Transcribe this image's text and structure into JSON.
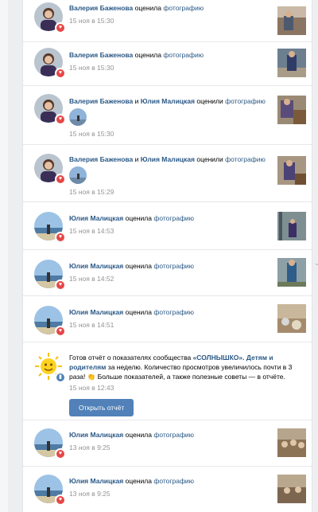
{
  "feed": {
    "items": [
      {
        "actor": "Валерия Баженова",
        "verb": "оценила",
        "object": "фотографию",
        "time": "15 ноя в 15:30",
        "avatar": "valeria",
        "thumb": "room1"
      },
      {
        "actor": "Валерия Баженова",
        "verb": "оценила",
        "object": "фотографию",
        "time": "15 ноя в 15:30",
        "avatar": "valeria",
        "thumb": "room2"
      },
      {
        "actor": "Валерия Баженова",
        "conj": "и",
        "actor2": "Юлия Малицкая",
        "verb": "оценили",
        "object": "фотографию",
        "time": "15 ноя в 15:30",
        "avatar": "valeria",
        "thumb": "room3"
      },
      {
        "actor": "Валерия Баженова",
        "conj": "и",
        "actor2": "Юлия Малицкая",
        "verb": "оценили",
        "object": "фотографию",
        "time": "15 ноя в 15:29",
        "avatar": "valeria",
        "thumb": "room4"
      },
      {
        "actor": "Юлия Малицкая",
        "verb": "оценила",
        "object": "фотографию",
        "time": "15 ноя в 14:53",
        "avatar": "yulia",
        "thumb": "room5"
      },
      {
        "actor": "Юлия Малицкая",
        "verb": "оценила",
        "object": "фотографию",
        "time": "15 ноя в 14:52",
        "avatar": "yulia",
        "thumb": "room6"
      },
      {
        "actor": "Юлия Малицкая",
        "verb": "оценила",
        "object": "фотографию",
        "time": "15 ноя в 14:51",
        "avatar": "yulia",
        "thumb": "room7"
      },
      {
        "actor": "Юлия Малицкая",
        "verb": "оценила",
        "object": "фотографию",
        "time": "13 ноя в 9:25",
        "avatar": "yulia",
        "thumb": "room8"
      },
      {
        "actor": "Юлия Малицкая",
        "verb": "оценила",
        "object": "фотографию",
        "time": "13 ноя в 9:25",
        "avatar": "yulia",
        "thumb": "room9"
      }
    ],
    "notice": {
      "part1": "Готов отчёт о показателях сообщества ",
      "community": "«СОЛНЫШКО». Детям и родителям",
      "part2": " за неделю. Количество просмотров увеличилось почти в 3 раза! ",
      "emoji": "👏",
      "part3": " Больше показателей, а также полезные советы — в отчёте.",
      "time": "15 ноя в 12:43",
      "button_label": "Открыть отчёт"
    }
  },
  "icons": {
    "heart": "heart-icon",
    "sun": "sun-icon",
    "chevron": "chevron-down-icon"
  },
  "colors": {
    "link": "#2a5885",
    "button": "#5181b8",
    "heart": "#e64646",
    "time": "#939393"
  }
}
